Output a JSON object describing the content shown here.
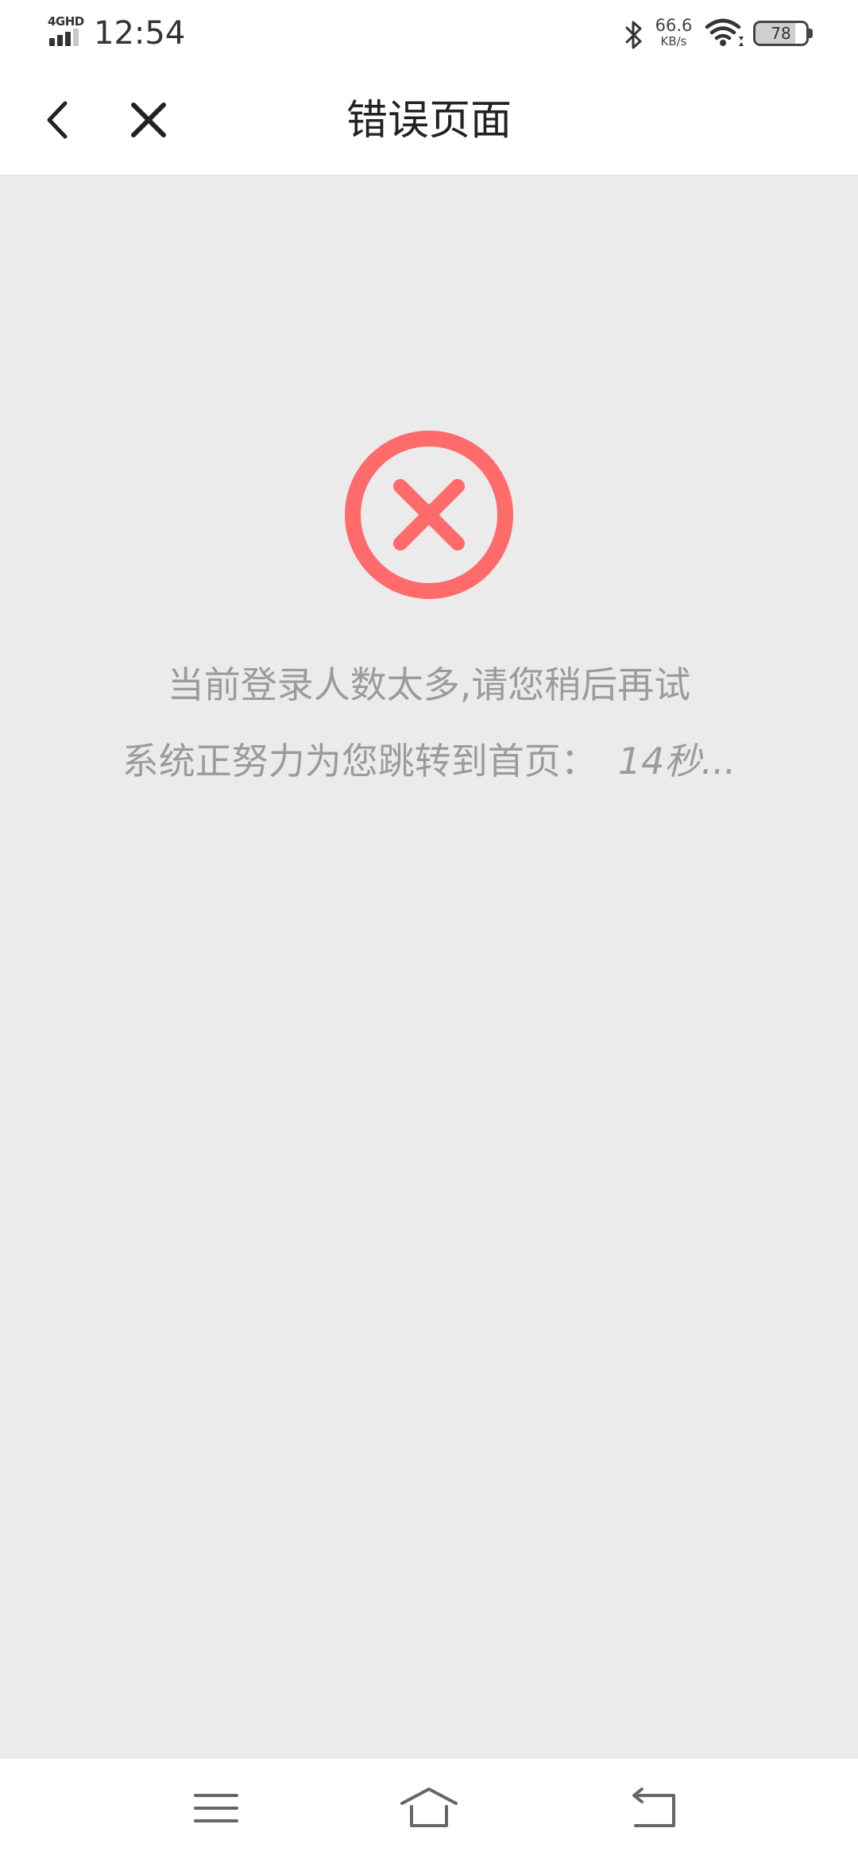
{
  "status_bar": {
    "network_type": "4GHD",
    "time": "12:54",
    "net_speed_value": "66.6",
    "net_speed_unit": "KB/s",
    "battery_level": "78",
    "battery_fraction": 0.78
  },
  "nav": {
    "title": "错误页面"
  },
  "error": {
    "message": "当前登录人数太多,请您稍后再试",
    "redirect_text": "系统正努力为您跳转到首页：",
    "countdown": "14秒...",
    "icon_color": "#ff6b6b"
  },
  "icons": {
    "status": [
      "signal-icon",
      "bluetooth-icon",
      "wifi-icon",
      "battery-icon"
    ],
    "nav": [
      "back-arrow-icon",
      "close-icon"
    ],
    "content": [
      "error-circle-x-icon"
    ],
    "bottom_nav": [
      "menu-icon",
      "home-icon",
      "back-icon"
    ]
  }
}
